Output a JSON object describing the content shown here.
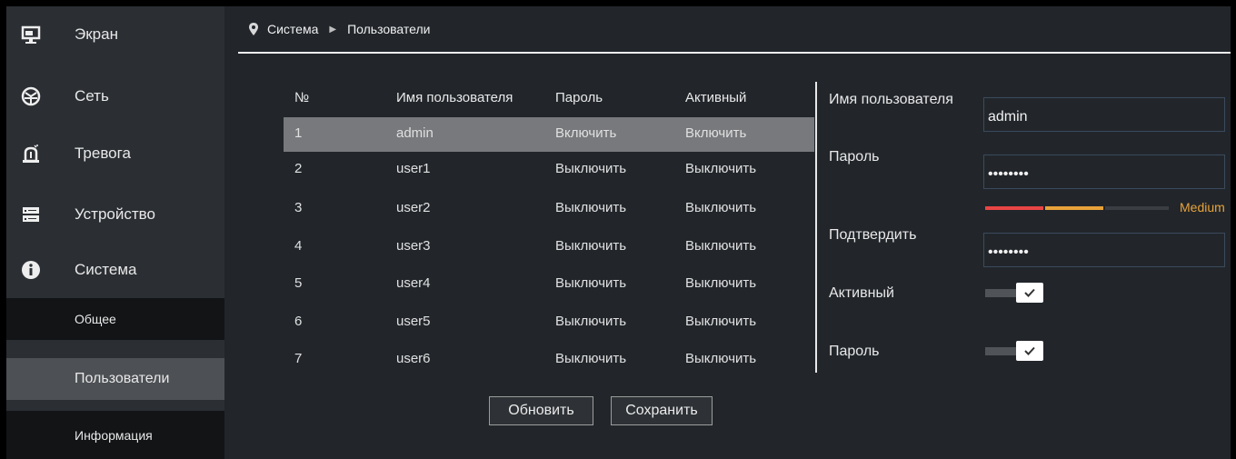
{
  "sidebar": {
    "items": [
      {
        "label": "Экран",
        "icon": "monitor-icon"
      },
      {
        "label": "Сеть",
        "icon": "network-icon"
      },
      {
        "label": "Тревога",
        "icon": "alarm-icon"
      },
      {
        "label": "Устройство",
        "icon": "device-icon"
      },
      {
        "label": "Система",
        "icon": "info-icon"
      }
    ],
    "subitems": [
      {
        "label": "Общее"
      },
      {
        "label": "Пользователи",
        "active": true
      },
      {
        "label": "Информация"
      }
    ]
  },
  "breadcrumb": {
    "section": "Система",
    "page": "Пользователи"
  },
  "table": {
    "headers": [
      "№",
      "Имя пользователя",
      "Пароль",
      "Активный"
    ],
    "rows": [
      {
        "num": "1",
        "user": "admin",
        "password": "Включить",
        "active": "Включить"
      },
      {
        "num": "2",
        "user": "user1",
        "password": "Выключить",
        "active": "Выключить"
      },
      {
        "num": "3",
        "user": "user2",
        "password": "Выключить",
        "active": "Выключить"
      },
      {
        "num": "4",
        "user": "user3",
        "password": "Выключить",
        "active": "Выключить"
      },
      {
        "num": "5",
        "user": "user4",
        "password": "Выключить",
        "active": "Выключить"
      },
      {
        "num": "6",
        "user": "user5",
        "password": "Выключить",
        "active": "Выключить"
      },
      {
        "num": "7",
        "user": "user6",
        "password": "Выключить",
        "active": "Выключить"
      }
    ]
  },
  "buttons": {
    "refresh": "Обновить",
    "save": "Сохранить"
  },
  "form": {
    "username_label": "Имя пользователя",
    "username_value": "admin",
    "password_label": "Пароль",
    "password_value": "••••••••",
    "strength_label": "Medium",
    "confirm_label": "Подтвердить",
    "confirm_value": "••••••••",
    "active_label": "Активный",
    "active_enabled": true,
    "password_toggle_label": "Пароль",
    "password_toggle_enabled": true
  },
  "colors": {
    "strength_weak": "#e84545",
    "strength_medium": "#e8a33a",
    "strength_empty": "#3a3d41",
    "selected_row": "#77797c"
  }
}
